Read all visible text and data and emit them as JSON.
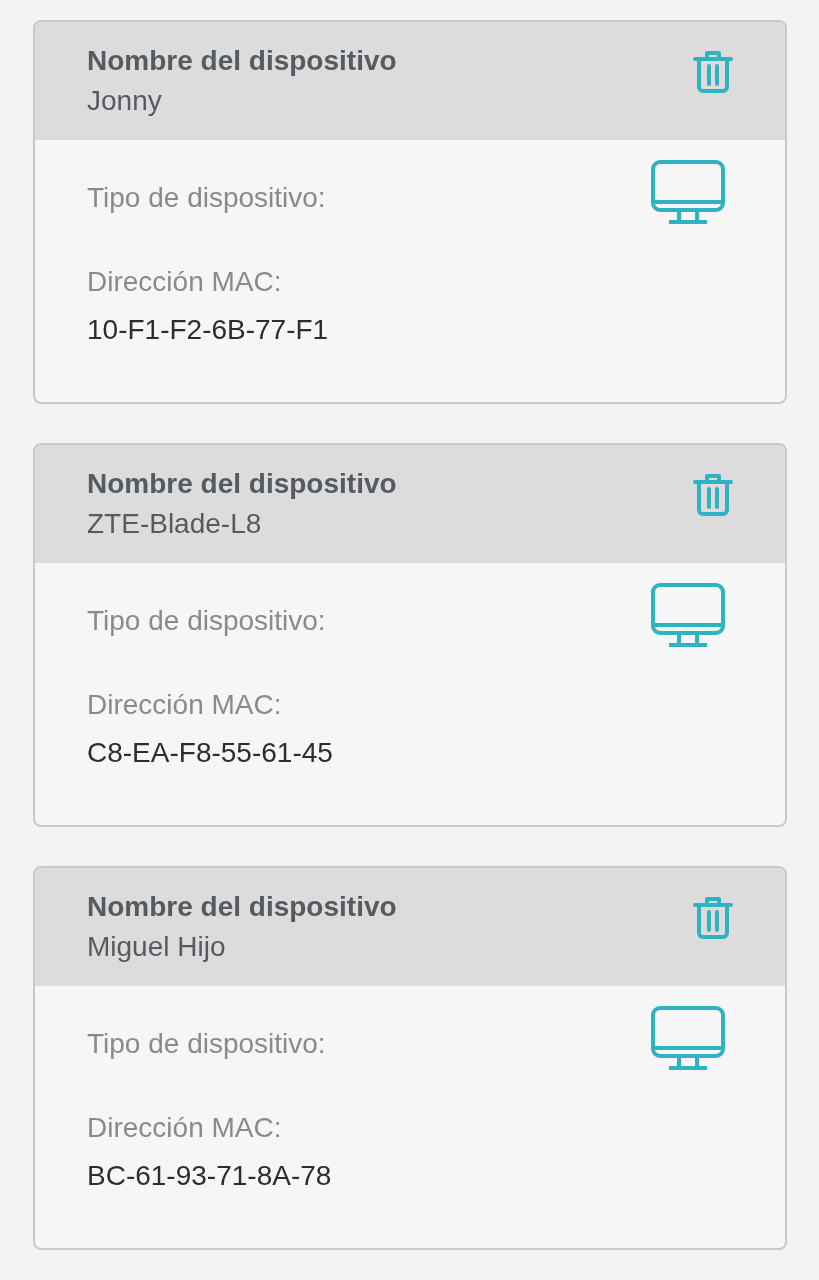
{
  "devices": [
    {
      "name_label": "Nombre del dispositivo",
      "name": "Jonny",
      "type_label": "Tipo de dispositivo:",
      "mac_label": "Dirección MAC:",
      "mac": "10-F1-F2-6B-77-F1"
    },
    {
      "name_label": "Nombre del dispositivo",
      "name": "ZTE-Blade-L8",
      "type_label": "Tipo de dispositivo:",
      "mac_label": "Dirección MAC:",
      "mac": "C8-EA-F8-55-61-45"
    },
    {
      "name_label": "Nombre del dispositivo",
      "name": "Miguel Hijo",
      "type_label": "Tipo de dispositivo:",
      "mac_label": "Dirección MAC:",
      "mac": "BC-61-93-71-8A-78"
    }
  ]
}
